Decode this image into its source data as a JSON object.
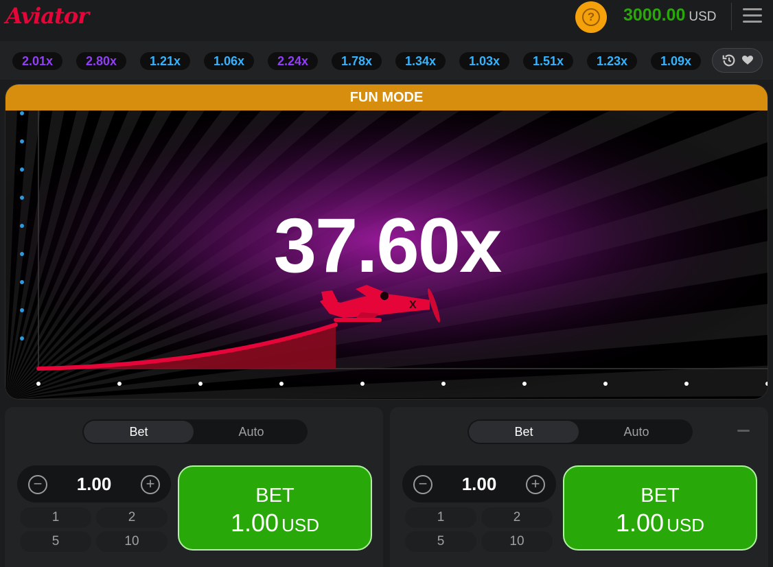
{
  "header": {
    "logo": "Aviator",
    "help_symbol": "?",
    "balance_amount": "3000.00",
    "balance_currency": "USD",
    "icons": {
      "help": "help-coin-icon",
      "menu": "hamburger-menu-icon"
    }
  },
  "history": {
    "items": [
      {
        "label": "2.01x",
        "color": "#913ef8"
      },
      {
        "label": "2.80x",
        "color": "#913ef8"
      },
      {
        "label": "1.21x",
        "color": "#34b4ff"
      },
      {
        "label": "1.06x",
        "color": "#34b4ff"
      },
      {
        "label": "2.24x",
        "color": "#913ef8"
      },
      {
        "label": "1.78x",
        "color": "#34b4ff"
      },
      {
        "label": "1.34x",
        "color": "#34b4ff"
      },
      {
        "label": "1.03x",
        "color": "#34b4ff"
      },
      {
        "label": "1.51x",
        "color": "#34b4ff"
      },
      {
        "label": "1.23x",
        "color": "#34b4ff"
      },
      {
        "label": "1.09x",
        "color": "#34b4ff"
      }
    ],
    "icons": {
      "history": "history-clock-icon",
      "dropdown": "dropdown-icon"
    }
  },
  "game": {
    "banner": "FUN MODE",
    "multiplier": "37.60x",
    "plane_mark": "X",
    "colors": {
      "curve": "#e50539",
      "glow": "#8a0f8f",
      "banner": "#d78d0d"
    }
  },
  "panels": [
    {
      "tabs": [
        "Bet",
        "Auto"
      ],
      "active_tab": "Bet",
      "amount": "1.00",
      "quick_amounts": [
        "1",
        "2",
        "5",
        "10"
      ],
      "bet_label": "BET",
      "bet_amount": "1.00",
      "bet_currency": "USD"
    },
    {
      "tabs": [
        "Bet",
        "Auto"
      ],
      "active_tab": "Bet",
      "amount": "1.00",
      "quick_amounts": [
        "1",
        "2",
        "5",
        "10"
      ],
      "bet_label": "BET",
      "bet_amount": "1.00",
      "bet_currency": "USD"
    }
  ],
  "colors": {
    "accent_green": "#28a909",
    "brand_red": "#e50539"
  }
}
